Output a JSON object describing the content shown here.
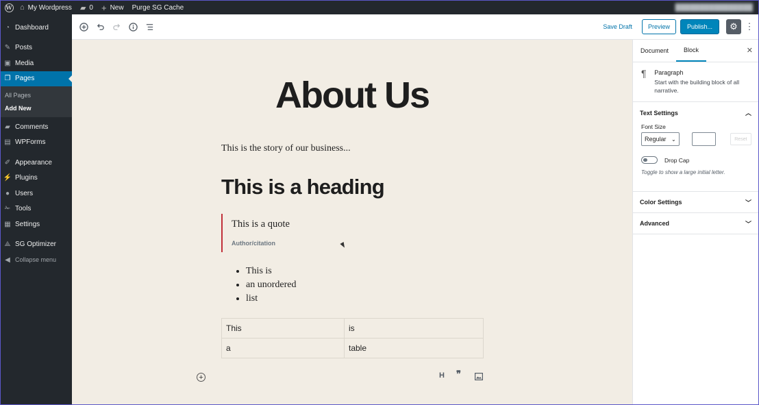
{
  "adminbar": {
    "site_name": "My Wordpress",
    "comments_count": "0",
    "new_label": "New",
    "purge_label": "Purge SG Cache"
  },
  "sidebar": {
    "items": [
      {
        "label": "Dashboard",
        "icon": "dashboard-icon"
      },
      {
        "label": "Posts",
        "icon": "pin-icon"
      },
      {
        "label": "Media",
        "icon": "media-icon"
      },
      {
        "label": "Pages",
        "icon": "pages-icon",
        "current": true
      },
      {
        "label": "Comments",
        "icon": "comments-icon"
      },
      {
        "label": "WPForms",
        "icon": "forms-icon"
      },
      {
        "label": "Appearance",
        "icon": "brush-icon"
      },
      {
        "label": "Plugins",
        "icon": "plug-icon"
      },
      {
        "label": "Users",
        "icon": "user-icon"
      },
      {
        "label": "Tools",
        "icon": "wrench-icon"
      },
      {
        "label": "Settings",
        "icon": "settings-icon"
      },
      {
        "label": "SG Optimizer",
        "icon": "sg-icon"
      },
      {
        "label": "Collapse menu",
        "icon": "collapse-icon"
      }
    ],
    "submenu": [
      "All Pages",
      "Add New"
    ]
  },
  "toolbar": {
    "save_draft": "Save Draft",
    "preview": "Preview",
    "publish": "Publish..."
  },
  "content": {
    "title": "About Us",
    "paragraph": "This is the story of our business...",
    "heading": "This is a heading",
    "quote": "This is a quote",
    "citation": "Author/citation",
    "list": [
      "This is",
      "an unordered",
      "list"
    ],
    "table": [
      [
        "This",
        "is"
      ],
      [
        "a",
        "table"
      ]
    ]
  },
  "panel": {
    "tab_document": "Document",
    "tab_block": "Block",
    "block_title": "Paragraph",
    "block_desc": "Start with the building block of all narrative.",
    "text_settings": "Text Settings",
    "font_size_label": "Font Size",
    "font_size_value": "Regular",
    "reset": "Reset",
    "drop_cap": "Drop Cap",
    "drop_cap_help": "Toggle to show a large initial letter.",
    "color_settings": "Color Settings",
    "advanced": "Advanced"
  },
  "colors": {
    "admin_dark": "#23282d",
    "accent": "#0073aa",
    "canvas_bg": "#f2ede4",
    "quote_border": "#c02f39"
  }
}
